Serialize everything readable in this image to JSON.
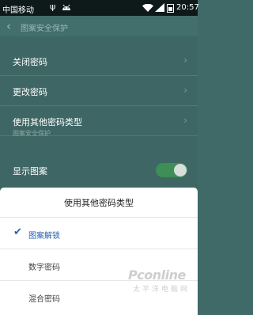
{
  "status_bar": {
    "carrier": "中国移动",
    "usb_symbol": "ψ",
    "time": "20:57"
  },
  "header": {
    "back_symbol": "‹",
    "title": "图案安全保护"
  },
  "rows": [
    {
      "label": "关闭密码"
    },
    {
      "label": "更改密码"
    },
    {
      "label": "使用其他密码类型"
    }
  ],
  "section_label": "图案安全保护",
  "show_pattern": {
    "label": "显示图案",
    "enabled": true
  },
  "chevron_symbol": "›",
  "sheet": {
    "title": "使用其他密码类型",
    "check_symbol": "✔",
    "options": [
      {
        "label": "图案解锁",
        "selected": true
      },
      {
        "label": "数字密码",
        "selected": false
      },
      {
        "label": "混合密码",
        "selected": false
      }
    ]
  },
  "watermark": {
    "logo": "Pconline",
    "sub": "太平洋电脑网"
  }
}
